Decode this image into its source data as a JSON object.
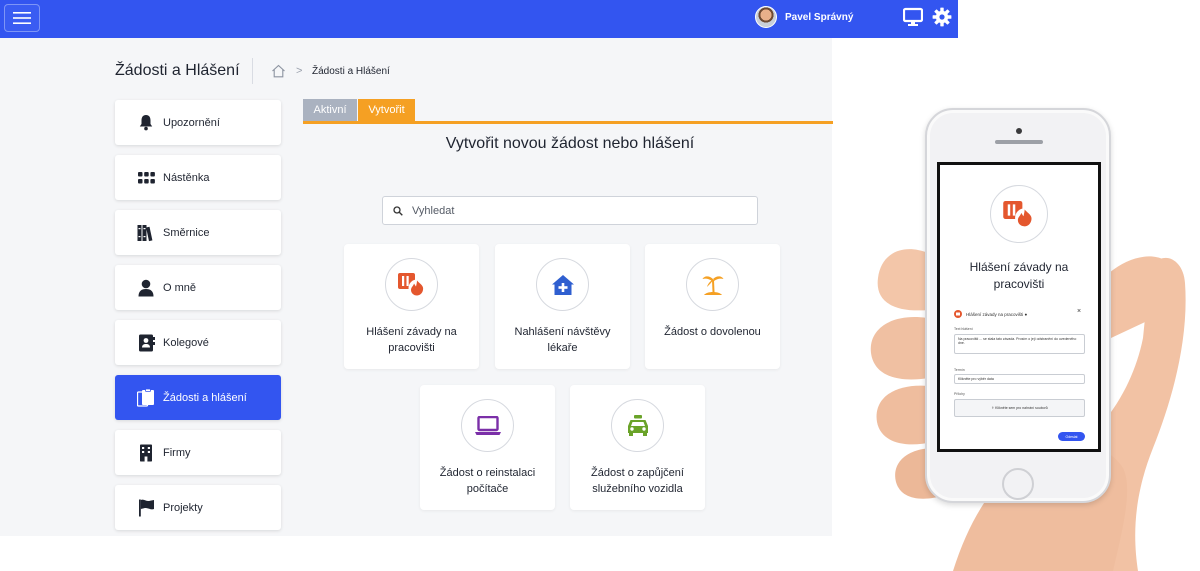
{
  "header": {
    "user_name": "Pavel Správný",
    "icons": [
      "menu-icon",
      "avatar",
      "monitor-icon",
      "gear-icon"
    ],
    "brand_color": "#3355f0"
  },
  "page": {
    "title": "Žádosti a Hlášení",
    "breadcrumb": {
      "separator": ">",
      "current": "Žádosti a Hlášení"
    }
  },
  "sidebar": {
    "items": [
      {
        "label": "Upozornění",
        "icon": "bell-icon",
        "active": false
      },
      {
        "label": "Nástěnka",
        "icon": "grid-icon",
        "active": false
      },
      {
        "label": "Směrnice",
        "icon": "books-icon",
        "active": false
      },
      {
        "label": "O mně",
        "icon": "user-icon",
        "active": false
      },
      {
        "label": "Kolegové",
        "icon": "contacts-icon",
        "active": false
      },
      {
        "label": "Žádosti a hlášení",
        "icon": "clipboard-icon",
        "active": true
      },
      {
        "label": "Firmy",
        "icon": "building-icon",
        "active": false
      },
      {
        "label": "Projekty",
        "icon": "flag-icon",
        "active": false
      }
    ]
  },
  "tabs": [
    {
      "label": "Aktivní",
      "active": false
    },
    {
      "label": "Vytvořit",
      "active": true
    }
  ],
  "main": {
    "heading": "Vytvořit novou žádost nebo hlášení",
    "search_placeholder": "Vyhledat",
    "cards": [
      {
        "label": "Hlášení závady na pracovišti",
        "icon": "fire-hazard-icon",
        "color": "#e4572e"
      },
      {
        "label": "Nahlášení návštěvy lékaře",
        "icon": "clinic-icon",
        "color": "#2f5fd0"
      },
      {
        "label": "Žádost o dovolenou",
        "icon": "palm-island-icon",
        "color": "#f5a023"
      },
      {
        "label": "Žádost o reinstalaci počítače",
        "icon": "laptop-icon",
        "color": "#7b2fa8"
      },
      {
        "label": "Žádost o zapůjčení služebního vozidla",
        "icon": "car-icon",
        "color": "#6aa329"
      }
    ]
  },
  "phone": {
    "title": "Hlášení závady na pracovišti",
    "form_header": "Hlášení závady na pracovišti ●",
    "close": "×",
    "fields": [
      {
        "label": "Text hlášení",
        "value": "Na pracovišti ... se stala tato závada. Prosím o její odstranění do uvedeného dne."
      },
      {
        "label": "Termín",
        "value": "Klikněte pro výběr data"
      },
      {
        "label": "Přílohy",
        "value": "⇪ Klikněte sem pro nahrání souborů"
      }
    ],
    "submit": "Odeslat"
  }
}
